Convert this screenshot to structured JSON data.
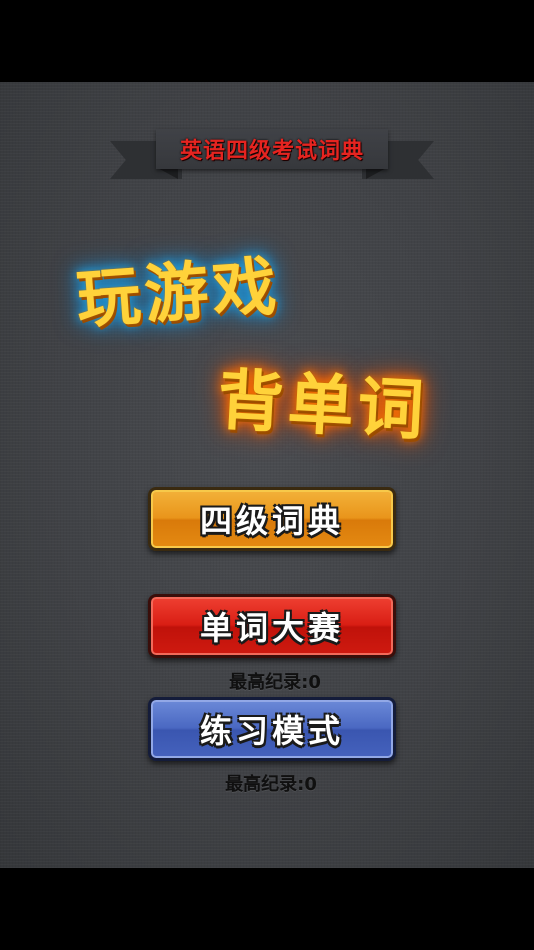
{
  "banner": {
    "text": "英语四级考试词典"
  },
  "title": {
    "line1": "玩游戏",
    "line2": "背单词"
  },
  "menu": {
    "dict_label": "四级词典",
    "contest_label": "单词大赛",
    "contest_score": "最高纪录:0",
    "practice_label": "练习模式",
    "practice_score": "最高纪录:0"
  },
  "colors": {
    "background": "#414347",
    "banner_text": "#e62420",
    "title_fill": "#ffd23a",
    "title1_glow": "#1ea7e6",
    "title2_glow": "#ff7a00",
    "dict_button": "#e9951b",
    "contest_button": "#d91e14",
    "practice_button": "#4a68c2"
  }
}
